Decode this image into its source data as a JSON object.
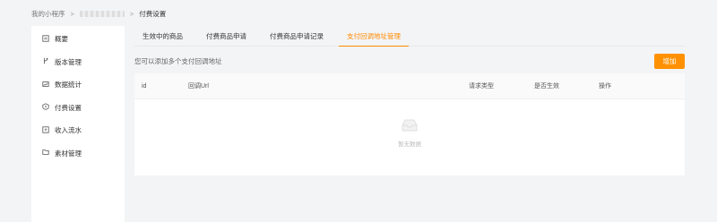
{
  "breadcrumb": {
    "root": "我的小程序",
    "sep1": ">",
    "sep2": ">",
    "current": "付费设置"
  },
  "sidebar": {
    "items": [
      {
        "label": "概要",
        "icon": "overview-icon"
      },
      {
        "label": "版本管理",
        "icon": "version-icon"
      },
      {
        "label": "数据统计",
        "icon": "chart-icon"
      },
      {
        "label": "付费设置",
        "icon": "payment-icon"
      },
      {
        "label": "收入流水",
        "icon": "income-icon"
      },
      {
        "label": "素材管理",
        "icon": "folder-icon"
      }
    ]
  },
  "tabs": [
    {
      "label": "生效中的商品",
      "active": false
    },
    {
      "label": "付费商品申请",
      "active": false
    },
    {
      "label": "付费商品申请记录",
      "active": false
    },
    {
      "label": "支付回调地址管理",
      "active": true
    }
  ],
  "main": {
    "hint": "您可以添加多个支付回调地址",
    "add_button": "增加"
  },
  "table": {
    "columns": [
      "id",
      "回调Url",
      "请求类型",
      "是否生效",
      "操作"
    ],
    "empty_text": "暂无数据"
  },
  "colors": {
    "accent": "#ff9100",
    "active_tab": "#ff8a00"
  }
}
